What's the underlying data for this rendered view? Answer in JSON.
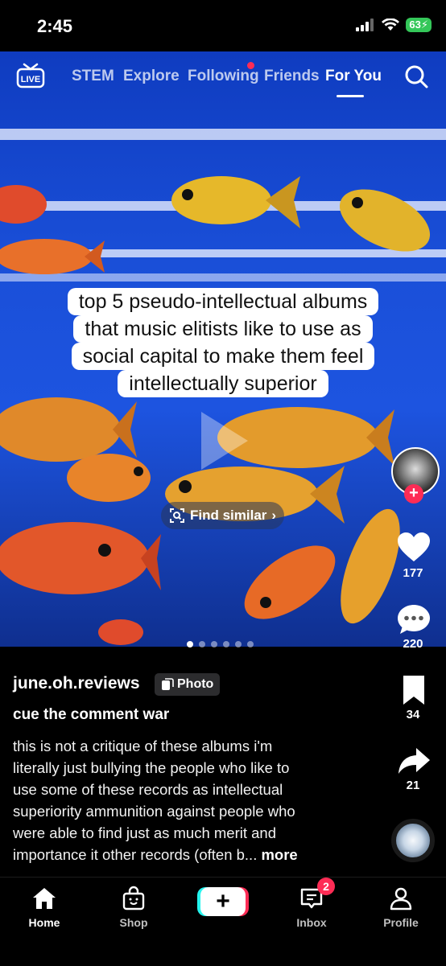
{
  "status_bar": {
    "time": "2:45",
    "battery": "63"
  },
  "top_nav": {
    "tabs": [
      {
        "label": "STEM"
      },
      {
        "label": "Explore"
      },
      {
        "label": "Following"
      },
      {
        "label": "Friends"
      },
      {
        "label": "For You"
      }
    ],
    "active_tab": "For You",
    "live_icon": "live-tv-icon",
    "search_icon": "search-icon"
  },
  "post": {
    "caption_lines": [
      "top 5 pseudo-intellectual albums",
      "that music elitists like to use as",
      "social capital to make them feel",
      "intellectually superior"
    ],
    "find_similar": "Find similar",
    "page_count": 6,
    "current_page": 1,
    "username": "june.oh.reviews",
    "type_badge": "Photo",
    "title": "cue the comment war",
    "body_lines": [
      "this is not a critique of these albums i'm",
      "literally just bullying the people who like to",
      "use some of these records as intellectual",
      "superiority ammunition against people who",
      "were able to find just as much merit and",
      "importance it other records (often b..."
    ],
    "more_label": "more"
  },
  "rail": {
    "likes": "177",
    "comments": "220",
    "bookmarks": "34",
    "shares": "21"
  },
  "bottom_nav": {
    "items": [
      {
        "label": "Home",
        "icon": "home-icon"
      },
      {
        "label": "Shop",
        "icon": "shop-bag-icon"
      },
      {
        "label": "",
        "icon": "create-plus-icon"
      },
      {
        "label": "Inbox",
        "icon": "inbox-icon"
      },
      {
        "label": "Profile",
        "icon": "profile-icon"
      }
    ],
    "inbox_badge": "2"
  },
  "colors": {
    "accent_red": "#fe2c55",
    "accent_cyan": "#25f4ee",
    "battery_green": "#34c759"
  }
}
